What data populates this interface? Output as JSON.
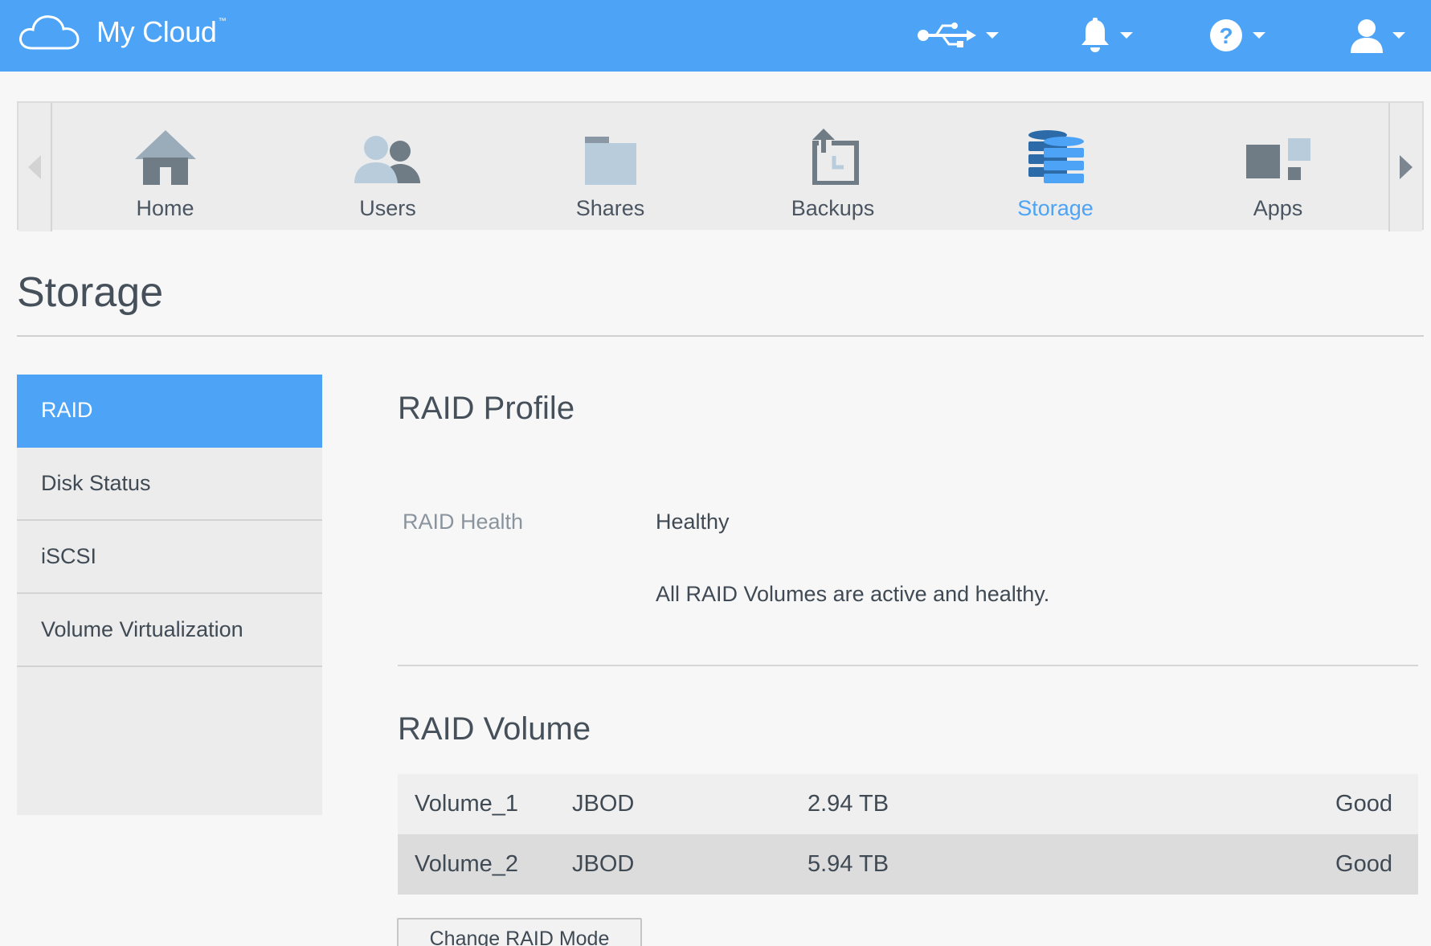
{
  "header": {
    "logo_text": "My Cloud",
    "logo_tm": "™",
    "icons": [
      "usb-icon",
      "bell-icon",
      "help-icon",
      "user-icon"
    ]
  },
  "nav": {
    "items": [
      {
        "label": "Home",
        "icon": "home-icon",
        "active": false
      },
      {
        "label": "Users",
        "icon": "users-icon",
        "active": false
      },
      {
        "label": "Shares",
        "icon": "folder-icon",
        "active": false
      },
      {
        "label": "Backups",
        "icon": "backup-icon",
        "active": false
      },
      {
        "label": "Storage",
        "icon": "storage-icon",
        "active": true
      },
      {
        "label": "Apps",
        "icon": "apps-icon",
        "active": false
      }
    ]
  },
  "page": {
    "title": "Storage"
  },
  "sidebar": {
    "items": [
      {
        "label": "RAID",
        "active": true
      },
      {
        "label": "Disk Status",
        "active": false
      },
      {
        "label": "iSCSI",
        "active": false
      },
      {
        "label": "Volume Virtualization",
        "active": false
      }
    ]
  },
  "raid_profile": {
    "title": "RAID Profile",
    "health_label": "RAID Health",
    "health_value": "Healthy",
    "health_message": "All RAID Volumes are active and healthy."
  },
  "raid_volume": {
    "title": "RAID Volume",
    "rows": [
      {
        "name": "Volume_1",
        "type": "JBOD",
        "size": "2.94 TB",
        "status": "Good"
      },
      {
        "name": "Volume_2",
        "type": "JBOD",
        "size": "5.94 TB",
        "status": "Good"
      }
    ],
    "change_button": "Change RAID Mode"
  },
  "colors": {
    "accent": "#4da3f5",
    "topbar": "#4da3f5",
    "nav_icon": "#6f7b85",
    "nav_icon_light": "#b8ccdb"
  }
}
